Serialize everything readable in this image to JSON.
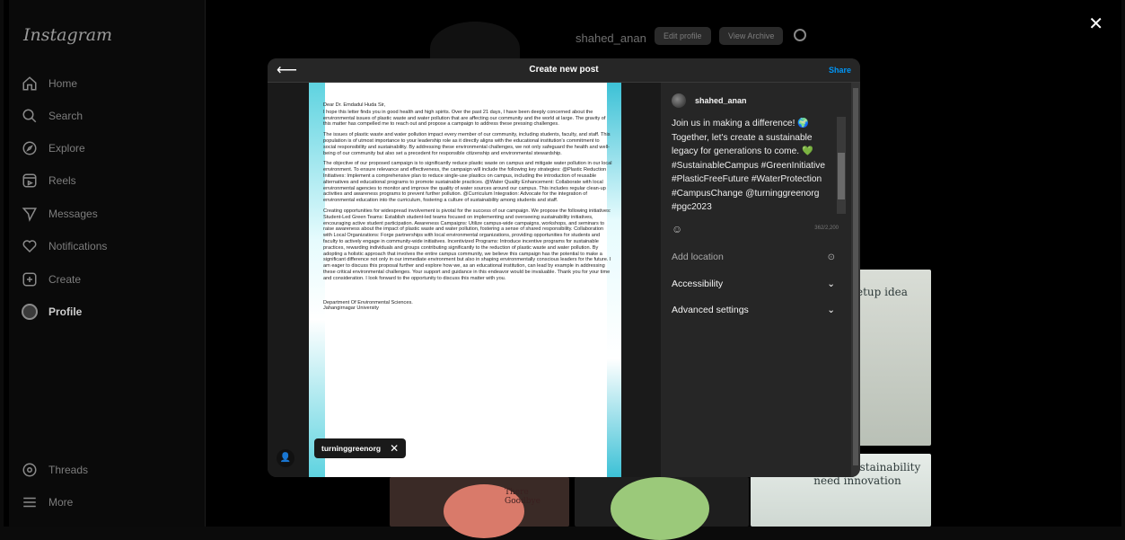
{
  "app": {
    "logo": "Instagram"
  },
  "sidebar": {
    "items": [
      {
        "label": "Home",
        "icon": "home-icon"
      },
      {
        "label": "Search",
        "icon": "search-icon"
      },
      {
        "label": "Explore",
        "icon": "explore-icon"
      },
      {
        "label": "Reels",
        "icon": "reels-icon"
      },
      {
        "label": "Messages",
        "icon": "messages-icon"
      },
      {
        "label": "Notifications",
        "icon": "heart-icon"
      },
      {
        "label": "Create",
        "icon": "create-icon"
      },
      {
        "label": "Profile",
        "icon": "profile-icon"
      }
    ],
    "threads": "Threads",
    "more": "More"
  },
  "profile_header": {
    "username": "shahed_anan",
    "edit_label": "Edit profile",
    "archive_label": "View Archive"
  },
  "background_posts": {
    "tile_a": "etup idea",
    "tile_b": "rd where sustainability need innovation",
    "tile_c": "There Goodbye"
  },
  "modal": {
    "title": "Create new post",
    "share": "Share",
    "tag_chip": "turninggreenorg",
    "author": "shahed_anan",
    "caption": "Join us in making a difference! 🌍 Together, let's create a sustainable legacy for generations to come. 💚 #SustainableCampus #GreenInitiative #PlasticFreeFuture #WaterProtection #CampusChange @turninggreenorg #pgc2023",
    "char_count": "362/2,200",
    "add_location": "Add location",
    "accessibility": "Accessibility",
    "advanced": "Advanced settings"
  },
  "letter": {
    "greeting": "Dear Dr. Emdadul Huda Sir,",
    "p1": "I hope this letter finds you in good health and high spirits. Over the past 21 days, I have been deeply concerned about the environmental issues of plastic waste and water pollution that are affecting our community and the world at large. The gravity of this matter has compelled me to reach out and propose a campaign to address these pressing challenges.",
    "p2": "The issues of plastic waste and water pollution impact every member of our community, including students, faculty, and staff. This population is of utmost importance to your leadership role as it directly aligns with the educational institution's commitment to social responsibility and sustainability. By addressing these environmental challenges, we not only safeguard the health and well-being of our community but also set a precedent for responsible citizenship and environmental stewardship.",
    "p3": "The objective of our proposed campaign is to significantly reduce plastic waste on campus and mitigate water pollution in our local environment. To ensure relevance and effectiveness, the campaign will include the following key strategies: @Plastic Reduction Initiatives: Implement a comprehensive plan to reduce single-use plastics on campus, including the introduction of reusable alternatives and educational programs to promote sustainable practices. @Water Quality Enhancement: Collaborate with local environmental agencies to monitor and improve the quality of water sources around our campus. This includes regular clean-up activities and awareness programs to prevent further pollution. @Curriculum Integration: Advocate for the integration of environmental education into the curriculum, fostering a culture of sustainability among students and staff.",
    "p4": "Creating opportunities for widespread involvement is pivotal for the success of our campaign. We propose the following initiatives: Student-Led Green Teams: Establish student-led teams focused on implementing and overseeing sustainability initiatives, encouraging active student participation. Awareness Campaigns: Utilize campus-wide campaigns, workshops, and seminars to raise awareness about the impact of plastic waste and water pollution, fostering a sense of shared responsibility. Collaboration with Local Organizations: Forge partnerships with local environmental organizations, providing opportunities for students and faculty to actively engage in community-wide initiatives. Incentivized Programs: Introduce incentive programs for sustainable practices, rewarding individuals and groups contributing significantly to the reduction of plastic waste and water pollution. By adopting a holistic approach that involves the entire campus community, we believe this campaign has the potential to make a significant difference not only in our immediate environment but also in shaping environmentally conscious leaders for the future. I am eager to discuss this proposal further and explore how we, as an educational institution, can lead by example in addressing these critical environmental challenges. Your support and guidance in this endeavor would be invaluable. Thank you for your time and consideration. I look forward to the opportunity to discuss this matter with you.",
    "sign1": "Department Of Environmental Sciences.",
    "sign2": "Jahangirnagar University"
  },
  "colors": {
    "share_blue": "#0095f6",
    "modal_bg": "#262626"
  }
}
